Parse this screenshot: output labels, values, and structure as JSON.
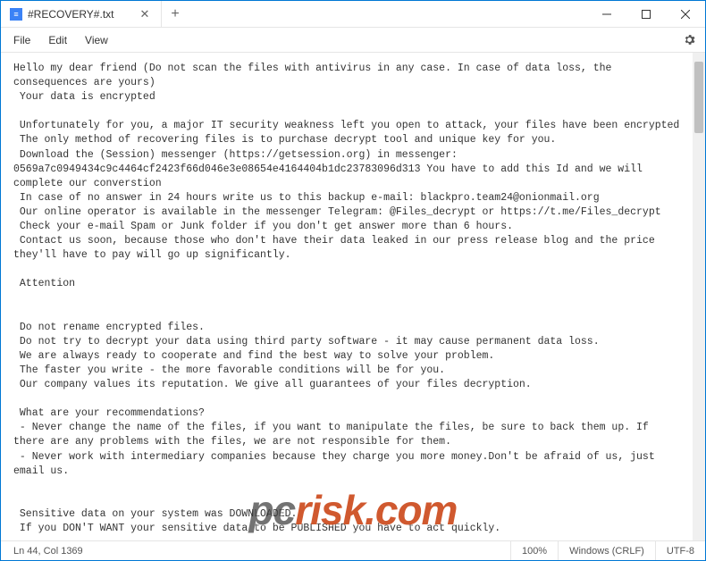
{
  "titlebar": {
    "tab_title": "#RECOVERY#.txt",
    "tab_icon": "≡"
  },
  "menu": {
    "file": "File",
    "edit": "Edit",
    "view": "View"
  },
  "content": "Hello my dear friend (Do not scan the files with antivirus in any case. In case of data loss, the consequences are yours)\n Your data is encrypted\n\n Unfortunately for you, a major IT security weakness left you open to attack, your files have been encrypted\n The only method of recovering files is to purchase decrypt tool and unique key for you.\n Download the (Session) messenger (https://getsession.org) in messenger:\n0569a7c0949434c9c4464cf2423f66d046e3e08654e4164404b1dc23783096d313 You have to add this Id and we will complete our converstion\n In case of no answer in 24 hours write us to this backup e-mail: blackpro.team24@onionmail.org\n Our online operator is available in the messenger Telegram: @Files_decrypt or https://t.me/Files_decrypt\n Check your e-mail Spam or Junk folder if you don't get answer more than 6 hours.\n Contact us soon, because those who don't have their data leaked in our press release blog and the price they'll have to pay will go up significantly.\n\n Attention\n\n\n Do not rename encrypted files.\n Do not try to decrypt your data using third party software - it may cause permanent data loss.\n We are always ready to cooperate and find the best way to solve your problem.\n The faster you write - the more favorable conditions will be for you.\n Our company values its reputation. We give all guarantees of your files decryption.\n\n What are your recommendations?\n - Never change the name of the files, if you want to manipulate the files, be sure to back them up. If there are any problems with the files, we are not responsible for them.\n - Never work with intermediary companies because they charge you more money.Don't be afraid of us, just email us.\n\n\n Sensitive data on your system was DOWNLOADED.\n If you DON'T WANT your sensitive data to be PUBLISHED you have to act quickly.\n\n Data includes:\n - Employees personal data, CVs, DL, SSN.\n - Complete network map including credentials for local and remote services.\n - Private financial information including: clients data, bills, budgets, annual reports, bank statements.",
  "status": {
    "position": "Ln 44, Col 1369",
    "zoom": "100%",
    "line_ending": "Windows (CRLF)",
    "encoding": "UTF-8"
  },
  "watermark": {
    "prefix": "pc",
    "suffix": "risk.com"
  }
}
